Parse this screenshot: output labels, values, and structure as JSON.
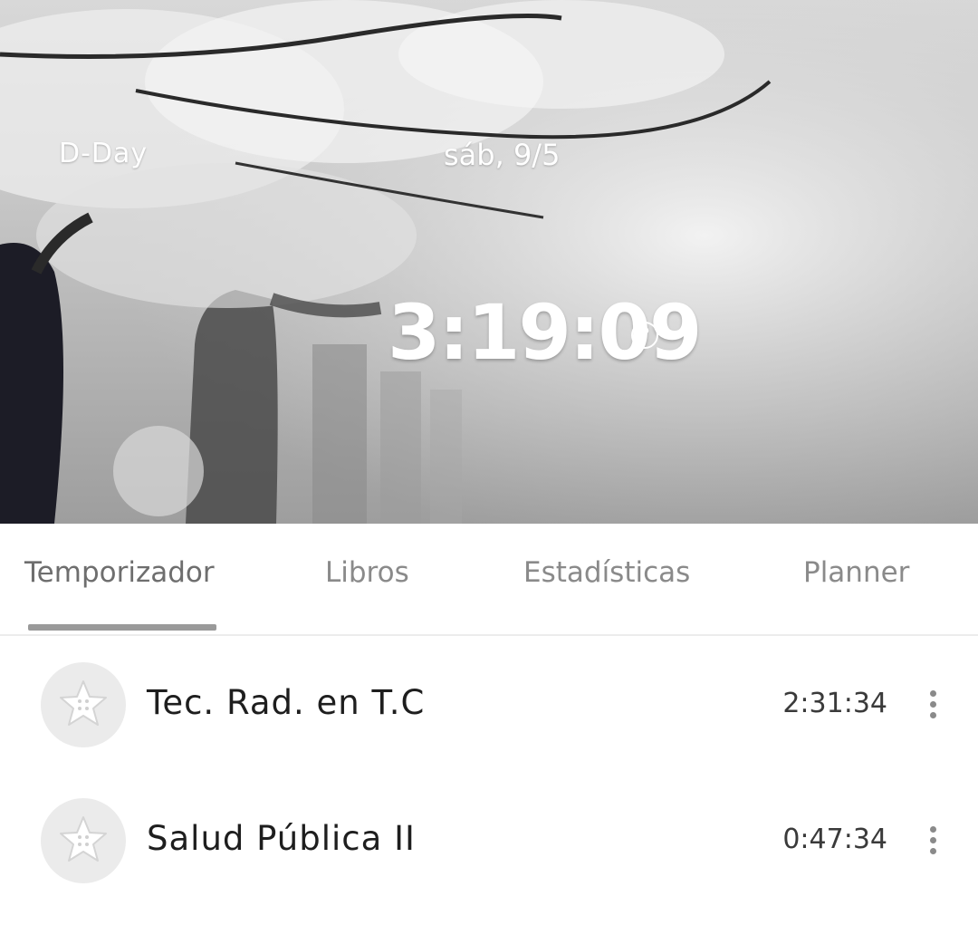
{
  "header": {
    "dday_label": "D-Day",
    "date": "sáb, 9/5",
    "timer": "3:19:09",
    "help_icon": "help-circle-icon"
  },
  "tabs": [
    {
      "label": "Temporizador",
      "active": true
    },
    {
      "label": "Libros",
      "active": false
    },
    {
      "label": "Estadísticas",
      "active": false
    },
    {
      "label": "Planner",
      "active": false
    }
  ],
  "subjects": [
    {
      "name": "Tec. Rad. en T.C",
      "time": "2:31:34",
      "icon": "star-button-icon"
    },
    {
      "name": "Salud Pública II",
      "time": "0:47:34",
      "icon": "star-button-icon"
    }
  ],
  "colors": {
    "tab_indicator": "#9a9a9a",
    "icon_background": "#ebebeb"
  }
}
